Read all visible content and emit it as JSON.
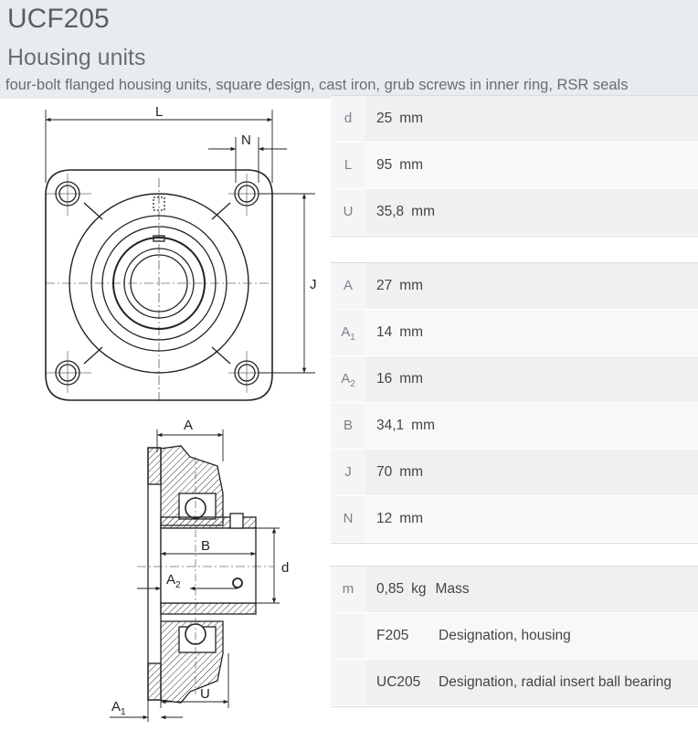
{
  "header": {
    "title": "UCF205",
    "subtitle": "Housing units",
    "description": "four-bolt flanged housing units, square design, cast iron, grub screws in inner ring, RSR seals"
  },
  "drawing": {
    "labels": {
      "L": "L",
      "N": "N",
      "J": "J",
      "A": "A",
      "B": "B",
      "d": "d",
      "A2": "A",
      "A2_sub": "2",
      "A1": "A",
      "A1_sub": "1",
      "U": "U"
    }
  },
  "table_main": [
    {
      "symbol": "d",
      "value": "25",
      "unit": "mm"
    },
    {
      "symbol": "L",
      "value": "95",
      "unit": "mm"
    },
    {
      "symbol": "U",
      "value": "35,8",
      "unit": "mm"
    }
  ],
  "table_dims": [
    {
      "symbol": "A",
      "sub": "",
      "value": "27",
      "unit": "mm"
    },
    {
      "symbol": "A",
      "sub": "1",
      "value": "14",
      "unit": "mm"
    },
    {
      "symbol": "A",
      "sub": "2",
      "value": "16",
      "unit": "mm"
    },
    {
      "symbol": "B",
      "sub": "",
      "value": "34,1",
      "unit": "mm"
    },
    {
      "symbol": "J",
      "sub": "",
      "value": "70",
      "unit": "mm"
    },
    {
      "symbol": "N",
      "sub": "",
      "value": "12",
      "unit": "mm"
    }
  ],
  "table_mass": {
    "symbol": "m",
    "value": "0,85",
    "unit": "kg",
    "label": "Mass",
    "housing_code": "F205",
    "housing_label": "Designation, housing",
    "bearing_code": "UC205",
    "bearing_label": "Designation, radial insert ball bearing"
  }
}
